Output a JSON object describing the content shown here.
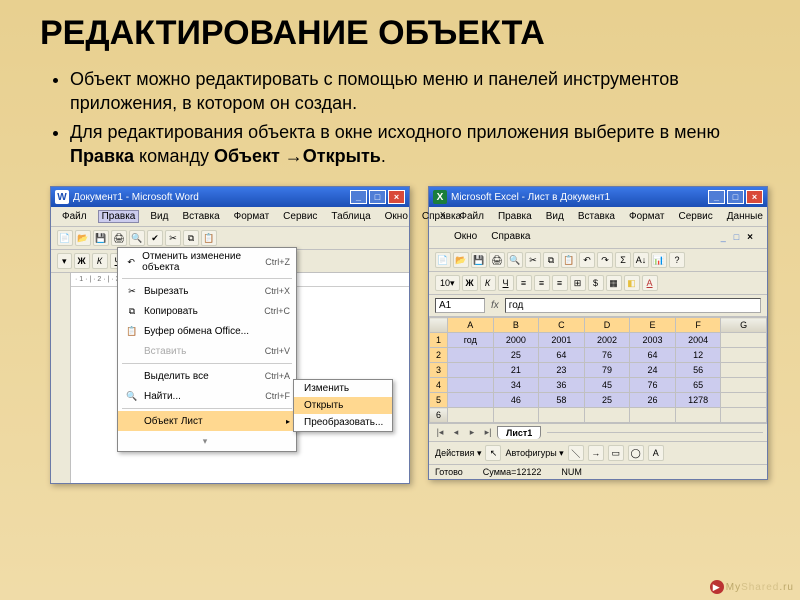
{
  "slide": {
    "title": "РЕДАКТИРОВАНИЕ ОБЪЕКТА",
    "bullet1": "Объект можно редактировать с помощью меню и панелей инструментов приложения, в котором он создан.",
    "bullet2_pre": "Для редактирования объекта в окне исходного приложения выберите в меню ",
    "bullet2_b1": "Правка",
    "bullet2_mid": " команду ",
    "bullet2_b2": "Объект →Открыть",
    "bullet2_end": "."
  },
  "word": {
    "title": "Документ1 - Microsoft Word",
    "menus": [
      "Файл",
      "Правка",
      "Вид",
      "Вставка",
      "Формат",
      "Сервис",
      "Таблица",
      "Окно",
      "Справка"
    ],
    "edit_menu": [
      {
        "icon": "↶",
        "label": "Отменить изменение объекта",
        "shortcut": "Ctrl+Z"
      },
      {
        "sep": true
      },
      {
        "icon": "✂",
        "label": "Вырезать",
        "shortcut": "Ctrl+X"
      },
      {
        "icon": "⧉",
        "label": "Копировать",
        "shortcut": "Ctrl+C"
      },
      {
        "icon": "📋",
        "label": "Буфер обмена Office...",
        "shortcut": ""
      },
      {
        "icon": "",
        "label": "Вставить",
        "shortcut": "Ctrl+V",
        "disabled": true
      },
      {
        "sep": true
      },
      {
        "icon": "",
        "label": "Выделить все",
        "shortcut": "Ctrl+A"
      },
      {
        "icon": "🔍",
        "label": "Найти...",
        "shortcut": "Ctrl+F"
      },
      {
        "sep": true
      },
      {
        "icon": "",
        "label": "Объект Лист",
        "arrow": true,
        "highlight": true
      }
    ],
    "submenu": [
      {
        "label": "Изменить"
      },
      {
        "label": "Открыть",
        "highlight": true
      },
      {
        "label": "Преобразовать..."
      }
    ],
    "ruler": "· 1 · | · 2 · | · 3 · | · 4 · | · 5 · | · 6 · | · 7"
  },
  "excel": {
    "title": "Microsoft Excel - Лист в Документ1",
    "menus_row1": [
      "Файл",
      "Правка",
      "Вид",
      "Вставка",
      "Формат",
      "Сервис",
      "Данные"
    ],
    "menus_row2": [
      "Окно",
      "Справка"
    ],
    "cellref": "A1",
    "formula_val": "год",
    "font_size": "10",
    "sheet_tab": "Лист1",
    "drawing": {
      "actions": "Действия",
      "autoshapes": "Автофигуры"
    },
    "status": {
      "ready": "Готово",
      "sum": "Сумма=12122",
      "num": "NUM"
    }
  },
  "chart_data": {
    "type": "table",
    "title": "Лист в Документ1",
    "columns": [
      "A",
      "B",
      "C",
      "D",
      "E",
      "F",
      "G"
    ],
    "rows": [
      [
        "год",
        "2000",
        "2001",
        "2002",
        "2003",
        "2004",
        ""
      ],
      [
        "",
        "25",
        "64",
        "76",
        "64",
        "12",
        ""
      ],
      [
        "",
        "21",
        "23",
        "79",
        "24",
        "56",
        ""
      ],
      [
        "",
        "34",
        "36",
        "45",
        "76",
        "65",
        ""
      ],
      [
        "",
        "46",
        "58",
        "25",
        "26",
        "1278",
        ""
      ]
    ]
  },
  "watermark": {
    "a": "My",
    "b": "Shared",
    "c": ".ru"
  }
}
